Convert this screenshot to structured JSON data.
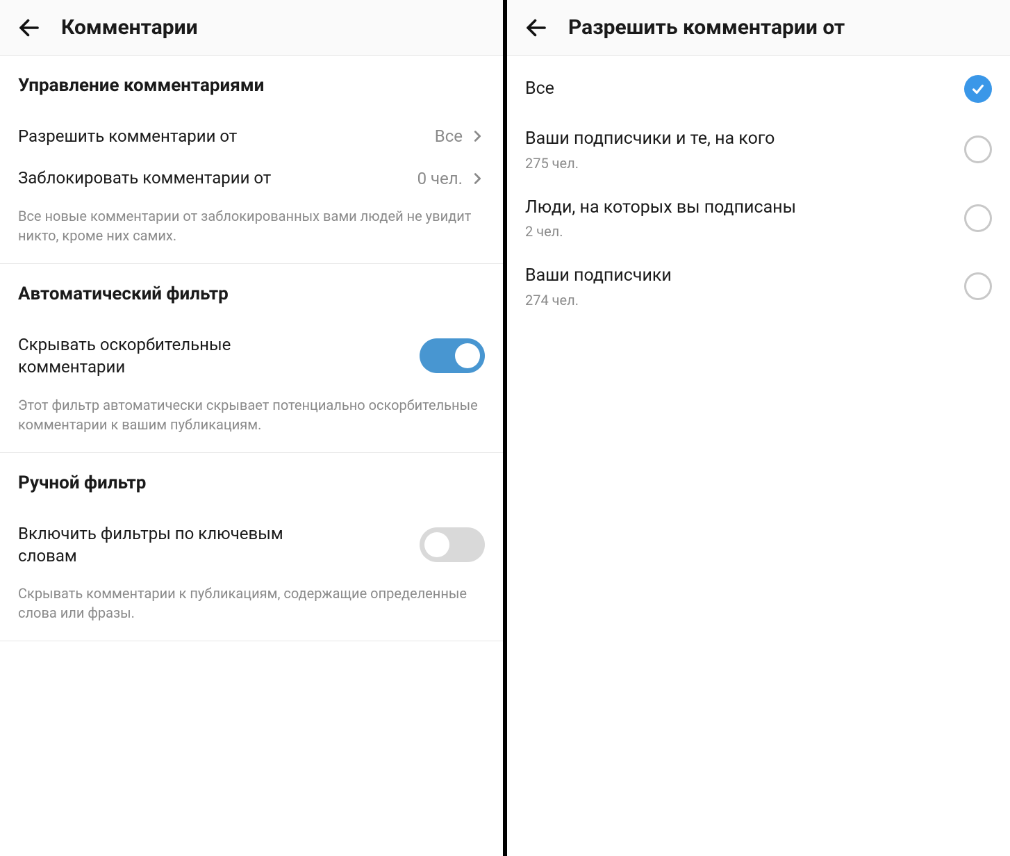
{
  "left": {
    "header_title": "Комментарии",
    "section1": {
      "title": "Управление комментариями",
      "allow_label": "Разрешить комментарии от",
      "allow_value": "Все",
      "block_label": "Заблокировать комментарии от",
      "block_value": "0 чел.",
      "desc": "Все новые комментарии от заблокированных вами людей не увидит никто, кроме них самих."
    },
    "section2": {
      "title": "Автоматический фильтр",
      "toggle_label": "Скрывать оскорбительные комментарии",
      "toggle_on": true,
      "desc": "Этот фильтр автоматически скрывает потенциально оскорбительные комментарии к вашим публикациям."
    },
    "section3": {
      "title": "Ручной фильтр",
      "toggle_label": "Включить фильтры по ключевым словам",
      "toggle_on": false,
      "desc": "Скрывать комментарии к публикациям, содержащие определенные слова или фразы."
    }
  },
  "right": {
    "header_title": "Разрешить комментарии от",
    "options": [
      {
        "label": "Все",
        "sub": "",
        "selected": true
      },
      {
        "label": "Ваши подписчики и те, на кого",
        "sub": "275 чел.",
        "selected": false
      },
      {
        "label": "Люди, на которых вы подписаны",
        "sub": "2 чел.",
        "selected": false
      },
      {
        "label": "Ваши подписчики",
        "sub": "274 чел.",
        "selected": false
      }
    ]
  }
}
